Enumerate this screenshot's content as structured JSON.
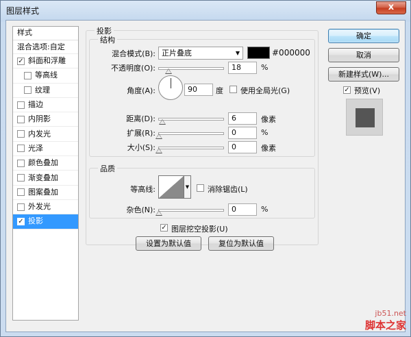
{
  "window": {
    "title": "图层样式",
    "close": "x"
  },
  "sidebar": {
    "header": "样式",
    "blend_options": "混合选项:自定",
    "items": [
      {
        "label": "斜面和浮雕",
        "checked": true,
        "sub": false
      },
      {
        "label": "等高线",
        "checked": false,
        "sub": true
      },
      {
        "label": "纹理",
        "checked": false,
        "sub": true
      },
      {
        "label": "描边",
        "checked": false,
        "sub": false
      },
      {
        "label": "内阴影",
        "checked": false,
        "sub": false
      },
      {
        "label": "内发光",
        "checked": false,
        "sub": false
      },
      {
        "label": "光泽",
        "checked": false,
        "sub": false
      },
      {
        "label": "颜色叠加",
        "checked": false,
        "sub": false
      },
      {
        "label": "渐变叠加",
        "checked": false,
        "sub": false
      },
      {
        "label": "图案叠加",
        "checked": false,
        "sub": false
      },
      {
        "label": "外发光",
        "checked": false,
        "sub": false
      },
      {
        "label": "投影",
        "checked": true,
        "sub": false,
        "selected": true
      }
    ]
  },
  "drop_shadow": {
    "group_title": "投影",
    "structure": {
      "title": "结构",
      "blend_mode_label": "混合模式(B):",
      "blend_mode_value": "正片叠底",
      "color_hex": "#000000",
      "opacity_label": "不透明度(O):",
      "opacity_value": "18",
      "opacity_unit": "%",
      "angle_label": "角度(A):",
      "angle_value": "90",
      "angle_unit": "度",
      "global_light_label": "使用全局光(G)",
      "distance_label": "距离(D):",
      "distance_value": "6",
      "distance_unit": "像素",
      "spread_label": "扩展(R):",
      "spread_value": "0",
      "spread_unit": "%",
      "size_label": "大小(S):",
      "size_value": "0",
      "size_unit": "像素"
    },
    "quality": {
      "title": "品质",
      "contour_label": "等高线:",
      "antialias_label": "消除锯齿(L)",
      "noise_label": "杂色(N):",
      "noise_value": "0",
      "noise_unit": "%"
    },
    "knockout_label": "图层挖空投影(U)",
    "make_default": "设置为默认值",
    "reset_default": "复位为默认值"
  },
  "buttons": {
    "ok": "确定",
    "cancel": "取消",
    "new_style": "新建样式(W)...",
    "preview": "预览(V)"
  },
  "watermark": {
    "line1": "jb51.net",
    "line2": "脚本之家"
  }
}
